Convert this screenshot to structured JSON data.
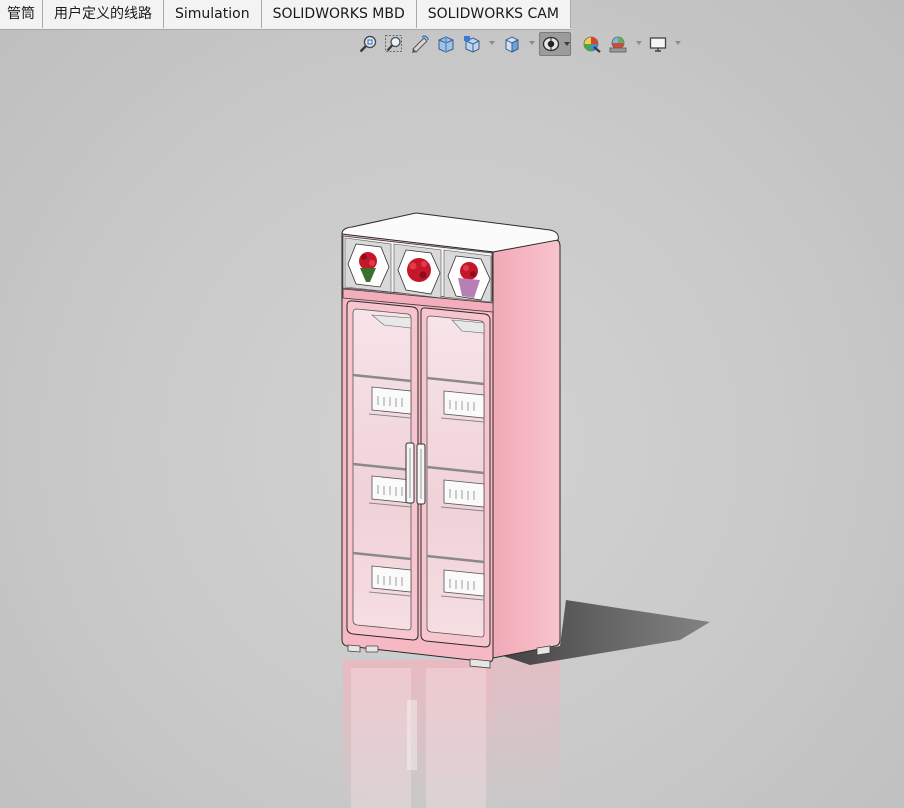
{
  "tabs": [
    {
      "label": "管筒"
    },
    {
      "label": "用户定义的线路"
    },
    {
      "label": "Simulation"
    },
    {
      "label": "SOLIDWORKS MBD"
    },
    {
      "label": "SOLIDWORKS CAM"
    }
  ],
  "hud_toolbar": {
    "tools": [
      {
        "icon": "zoom-to-fit-icon"
      },
      {
        "icon": "zoom-to-area-icon"
      },
      {
        "icon": "previous-view-icon"
      },
      {
        "icon": "section-view-icon"
      },
      {
        "icon": "view-orientation-icon"
      },
      {
        "icon": "display-style-icon"
      },
      {
        "icon": "hide-show-items-icon",
        "active": true
      },
      {
        "icon": "edit-appearance-icon"
      },
      {
        "icon": "apply-scene-icon"
      },
      {
        "icon": "view-settings-icon"
      }
    ]
  },
  "colors": {
    "viewport_background": "#c9c9c9",
    "cabinet_body": "#f6b8c3",
    "cabinet_top": "#fbfbfb",
    "glass": "#f2d6dc",
    "tab_background": "#f0f0f0"
  }
}
